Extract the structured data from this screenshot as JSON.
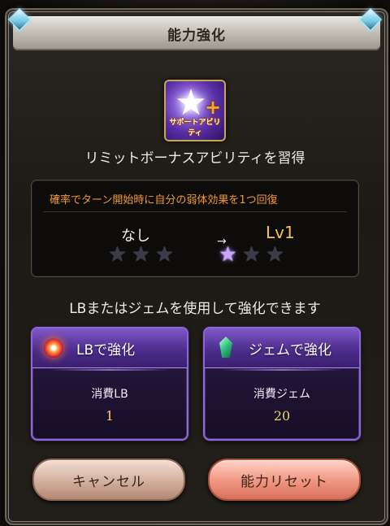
{
  "dialog": {
    "title": "能力強化"
  },
  "ability": {
    "icon_name": "support-ability-star-plus-icon",
    "icon_label": "サポートアビリティ",
    "learn_text": "リミットボーナスアビリティを習得"
  },
  "effect": {
    "description": "確率でターン開始時に自分の弱体効果を1つ回復",
    "before_level": "なし",
    "after_level": "Lv1",
    "arrow": "→",
    "before_stars_lit": 0,
    "after_stars_lit": 1,
    "max_stars": 3
  },
  "hint": "LBまたはジェムを使用して強化できます",
  "options": {
    "lb": {
      "title": "LBで強化",
      "cost_label": "消費LB",
      "cost_value": "1"
    },
    "gem": {
      "title": "ジェムで強化",
      "cost_label": "消費ジェム",
      "cost_value": "20"
    }
  },
  "buttons": {
    "cancel": "キャンセル",
    "reset": "能力リセット"
  },
  "colors": {
    "description": "#f29a2d",
    "after_level": "#f2c650",
    "card_border": "#8b67d1"
  }
}
